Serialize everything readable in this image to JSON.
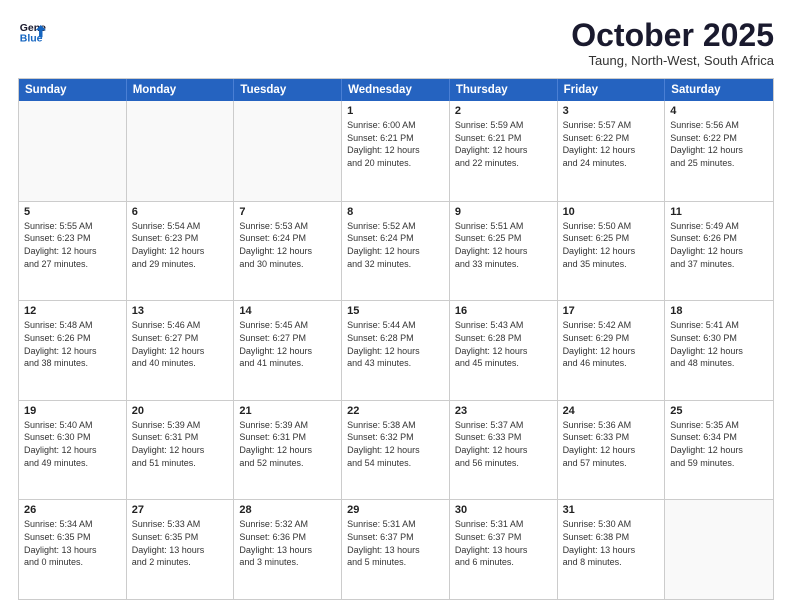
{
  "header": {
    "logo_line1": "General",
    "logo_line2": "Blue",
    "month": "October 2025",
    "location": "Taung, North-West, South Africa"
  },
  "days_of_week": [
    "Sunday",
    "Monday",
    "Tuesday",
    "Wednesday",
    "Thursday",
    "Friday",
    "Saturday"
  ],
  "weeks": [
    [
      {
        "day": "",
        "empty": true
      },
      {
        "day": "",
        "empty": true
      },
      {
        "day": "",
        "empty": true
      },
      {
        "day": "1",
        "lines": [
          "Sunrise: 6:00 AM",
          "Sunset: 6:21 PM",
          "Daylight: 12 hours",
          "and 20 minutes."
        ]
      },
      {
        "day": "2",
        "lines": [
          "Sunrise: 5:59 AM",
          "Sunset: 6:21 PM",
          "Daylight: 12 hours",
          "and 22 minutes."
        ]
      },
      {
        "day": "3",
        "lines": [
          "Sunrise: 5:57 AM",
          "Sunset: 6:22 PM",
          "Daylight: 12 hours",
          "and 24 minutes."
        ]
      },
      {
        "day": "4",
        "lines": [
          "Sunrise: 5:56 AM",
          "Sunset: 6:22 PM",
          "Daylight: 12 hours",
          "and 25 minutes."
        ]
      }
    ],
    [
      {
        "day": "5",
        "lines": [
          "Sunrise: 5:55 AM",
          "Sunset: 6:23 PM",
          "Daylight: 12 hours",
          "and 27 minutes."
        ]
      },
      {
        "day": "6",
        "lines": [
          "Sunrise: 5:54 AM",
          "Sunset: 6:23 PM",
          "Daylight: 12 hours",
          "and 29 minutes."
        ]
      },
      {
        "day": "7",
        "lines": [
          "Sunrise: 5:53 AM",
          "Sunset: 6:24 PM",
          "Daylight: 12 hours",
          "and 30 minutes."
        ]
      },
      {
        "day": "8",
        "lines": [
          "Sunrise: 5:52 AM",
          "Sunset: 6:24 PM",
          "Daylight: 12 hours",
          "and 32 minutes."
        ]
      },
      {
        "day": "9",
        "lines": [
          "Sunrise: 5:51 AM",
          "Sunset: 6:25 PM",
          "Daylight: 12 hours",
          "and 33 minutes."
        ]
      },
      {
        "day": "10",
        "lines": [
          "Sunrise: 5:50 AM",
          "Sunset: 6:25 PM",
          "Daylight: 12 hours",
          "and 35 minutes."
        ]
      },
      {
        "day": "11",
        "lines": [
          "Sunrise: 5:49 AM",
          "Sunset: 6:26 PM",
          "Daylight: 12 hours",
          "and 37 minutes."
        ]
      }
    ],
    [
      {
        "day": "12",
        "lines": [
          "Sunrise: 5:48 AM",
          "Sunset: 6:26 PM",
          "Daylight: 12 hours",
          "and 38 minutes."
        ]
      },
      {
        "day": "13",
        "lines": [
          "Sunrise: 5:46 AM",
          "Sunset: 6:27 PM",
          "Daylight: 12 hours",
          "and 40 minutes."
        ]
      },
      {
        "day": "14",
        "lines": [
          "Sunrise: 5:45 AM",
          "Sunset: 6:27 PM",
          "Daylight: 12 hours",
          "and 41 minutes."
        ]
      },
      {
        "day": "15",
        "lines": [
          "Sunrise: 5:44 AM",
          "Sunset: 6:28 PM",
          "Daylight: 12 hours",
          "and 43 minutes."
        ]
      },
      {
        "day": "16",
        "lines": [
          "Sunrise: 5:43 AM",
          "Sunset: 6:28 PM",
          "Daylight: 12 hours",
          "and 45 minutes."
        ]
      },
      {
        "day": "17",
        "lines": [
          "Sunrise: 5:42 AM",
          "Sunset: 6:29 PM",
          "Daylight: 12 hours",
          "and 46 minutes."
        ]
      },
      {
        "day": "18",
        "lines": [
          "Sunrise: 5:41 AM",
          "Sunset: 6:30 PM",
          "Daylight: 12 hours",
          "and 48 minutes."
        ]
      }
    ],
    [
      {
        "day": "19",
        "lines": [
          "Sunrise: 5:40 AM",
          "Sunset: 6:30 PM",
          "Daylight: 12 hours",
          "and 49 minutes."
        ]
      },
      {
        "day": "20",
        "lines": [
          "Sunrise: 5:39 AM",
          "Sunset: 6:31 PM",
          "Daylight: 12 hours",
          "and 51 minutes."
        ]
      },
      {
        "day": "21",
        "lines": [
          "Sunrise: 5:39 AM",
          "Sunset: 6:31 PM",
          "Daylight: 12 hours",
          "and 52 minutes."
        ]
      },
      {
        "day": "22",
        "lines": [
          "Sunrise: 5:38 AM",
          "Sunset: 6:32 PM",
          "Daylight: 12 hours",
          "and 54 minutes."
        ]
      },
      {
        "day": "23",
        "lines": [
          "Sunrise: 5:37 AM",
          "Sunset: 6:33 PM",
          "Daylight: 12 hours",
          "and 56 minutes."
        ]
      },
      {
        "day": "24",
        "lines": [
          "Sunrise: 5:36 AM",
          "Sunset: 6:33 PM",
          "Daylight: 12 hours",
          "and 57 minutes."
        ]
      },
      {
        "day": "25",
        "lines": [
          "Sunrise: 5:35 AM",
          "Sunset: 6:34 PM",
          "Daylight: 12 hours",
          "and 59 minutes."
        ]
      }
    ],
    [
      {
        "day": "26",
        "lines": [
          "Sunrise: 5:34 AM",
          "Sunset: 6:35 PM",
          "Daylight: 13 hours",
          "and 0 minutes."
        ]
      },
      {
        "day": "27",
        "lines": [
          "Sunrise: 5:33 AM",
          "Sunset: 6:35 PM",
          "Daylight: 13 hours",
          "and 2 minutes."
        ]
      },
      {
        "day": "28",
        "lines": [
          "Sunrise: 5:32 AM",
          "Sunset: 6:36 PM",
          "Daylight: 13 hours",
          "and 3 minutes."
        ]
      },
      {
        "day": "29",
        "lines": [
          "Sunrise: 5:31 AM",
          "Sunset: 6:37 PM",
          "Daylight: 13 hours",
          "and 5 minutes."
        ]
      },
      {
        "day": "30",
        "lines": [
          "Sunrise: 5:31 AM",
          "Sunset: 6:37 PM",
          "Daylight: 13 hours",
          "and 6 minutes."
        ]
      },
      {
        "day": "31",
        "lines": [
          "Sunrise: 5:30 AM",
          "Sunset: 6:38 PM",
          "Daylight: 13 hours",
          "and 8 minutes."
        ]
      },
      {
        "day": "",
        "empty": true
      }
    ]
  ]
}
